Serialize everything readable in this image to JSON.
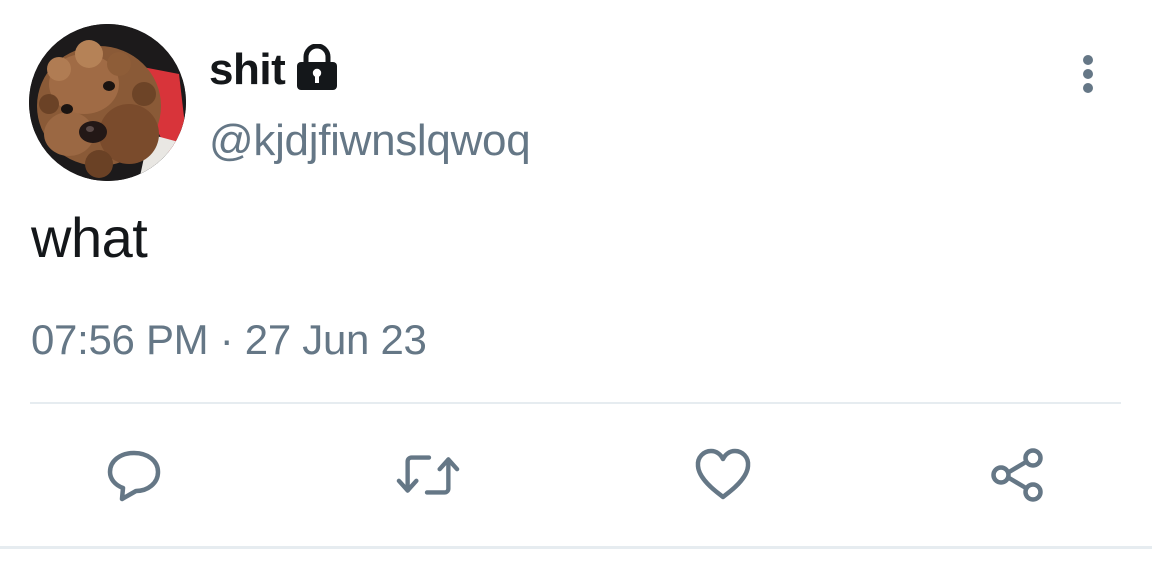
{
  "tweet": {
    "display_name": "shit",
    "handle": "@kjdjfiwnslqwoq",
    "text": "what",
    "timestamp": "07:56 PM · 27 Jun 23",
    "protected": true
  },
  "icons": {
    "lock": "lock-icon",
    "more": "more-vertical-icon",
    "reply": "reply-icon",
    "retweet": "retweet-icon",
    "like": "heart-icon",
    "share": "share-icon"
  },
  "colors": {
    "text_primary": "#14171a",
    "text_secondary": "#657786",
    "icon": "#657786",
    "divider": "#e6ecf0"
  }
}
